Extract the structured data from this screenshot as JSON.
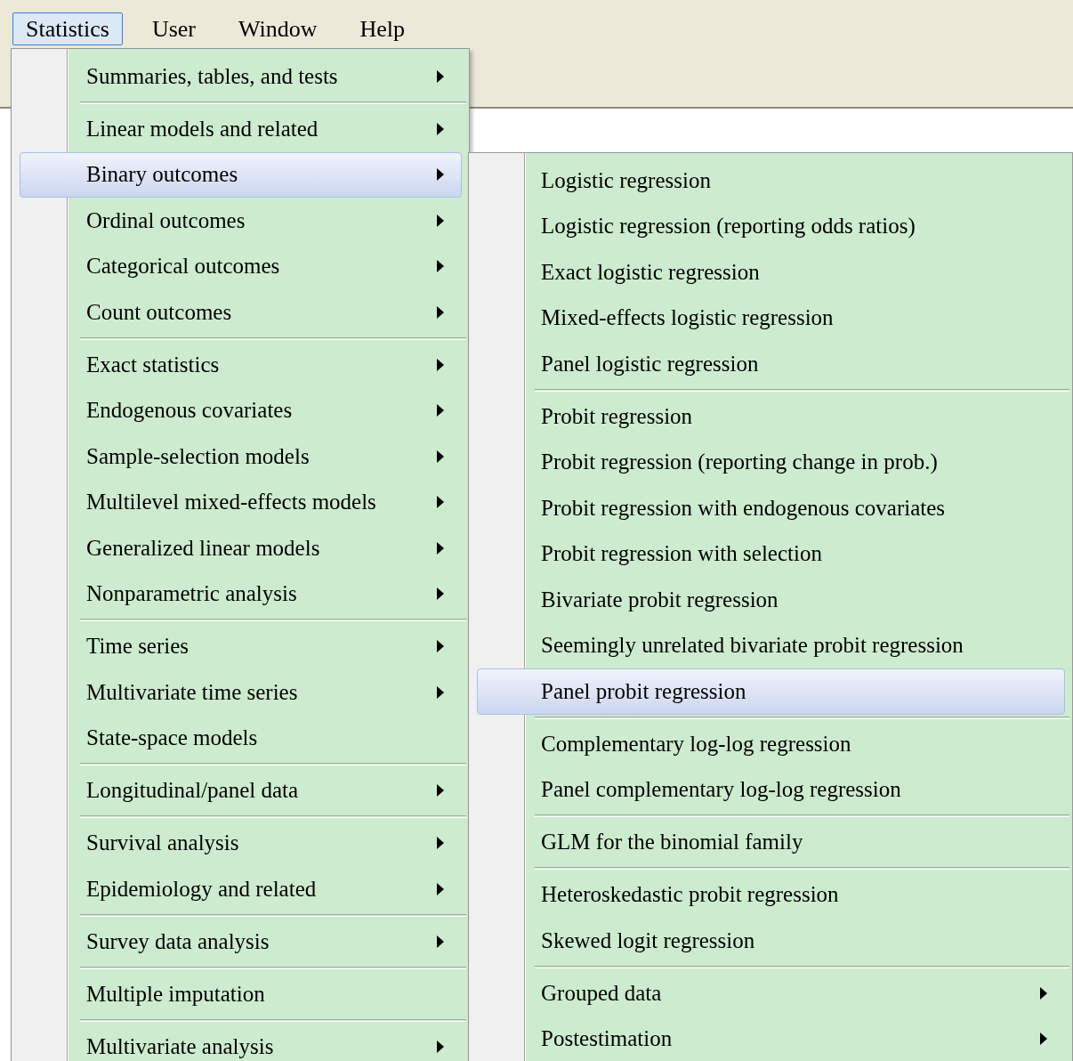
{
  "menu_bar": [
    {
      "label": "Statistics",
      "selected": true
    },
    {
      "label": "User",
      "selected": false
    },
    {
      "label": "Window",
      "selected": false
    },
    {
      "label": "Help",
      "selected": false
    }
  ],
  "statistics_menu": [
    {
      "kind": "item",
      "label": "Summaries, tables, and tests",
      "submenu": true,
      "selected": false
    },
    {
      "kind": "separator"
    },
    {
      "kind": "item",
      "label": "Linear models and related",
      "submenu": true,
      "selected": false
    },
    {
      "kind": "item",
      "label": "Binary outcomes",
      "submenu": true,
      "selected": true
    },
    {
      "kind": "item",
      "label": "Ordinal outcomes",
      "submenu": true,
      "selected": false
    },
    {
      "kind": "item",
      "label": "Categorical outcomes",
      "submenu": true,
      "selected": false
    },
    {
      "kind": "item",
      "label": "Count outcomes",
      "submenu": true,
      "selected": false
    },
    {
      "kind": "separator"
    },
    {
      "kind": "item",
      "label": "Exact statistics",
      "submenu": true,
      "selected": false
    },
    {
      "kind": "item",
      "label": "Endogenous covariates",
      "submenu": true,
      "selected": false
    },
    {
      "kind": "item",
      "label": "Sample-selection models",
      "submenu": true,
      "selected": false
    },
    {
      "kind": "item",
      "label": "Multilevel mixed-effects models",
      "submenu": true,
      "selected": false
    },
    {
      "kind": "item",
      "label": "Generalized linear models",
      "submenu": true,
      "selected": false
    },
    {
      "kind": "item",
      "label": "Nonparametric analysis",
      "submenu": true,
      "selected": false
    },
    {
      "kind": "separator"
    },
    {
      "kind": "item",
      "label": "Time series",
      "submenu": true,
      "selected": false
    },
    {
      "kind": "item",
      "label": "Multivariate time series",
      "submenu": true,
      "selected": false
    },
    {
      "kind": "item",
      "label": "State-space models",
      "submenu": false,
      "selected": false
    },
    {
      "kind": "separator"
    },
    {
      "kind": "item",
      "label": "Longitudinal/panel data",
      "submenu": true,
      "selected": false
    },
    {
      "kind": "separator"
    },
    {
      "kind": "item",
      "label": "Survival analysis",
      "submenu": true,
      "selected": false
    },
    {
      "kind": "item",
      "label": "Epidemiology and related",
      "submenu": true,
      "selected": false
    },
    {
      "kind": "separator"
    },
    {
      "kind": "item",
      "label": "Survey data analysis",
      "submenu": true,
      "selected": false
    },
    {
      "kind": "separator"
    },
    {
      "kind": "item",
      "label": "Multiple imputation",
      "submenu": false,
      "selected": false
    },
    {
      "kind": "separator"
    },
    {
      "kind": "item",
      "label": "Multivariate analysis",
      "submenu": true,
      "selected": false
    }
  ],
  "binary_outcomes_menu": [
    {
      "kind": "item",
      "label": "Logistic regression",
      "submenu": false,
      "selected": false
    },
    {
      "kind": "item",
      "label": "Logistic regression (reporting odds ratios)",
      "submenu": false,
      "selected": false
    },
    {
      "kind": "item",
      "label": "Exact logistic regression",
      "submenu": false,
      "selected": false
    },
    {
      "kind": "item",
      "label": "Mixed-effects logistic regression",
      "submenu": false,
      "selected": false
    },
    {
      "kind": "item",
      "label": "Panel logistic regression",
      "submenu": false,
      "selected": false
    },
    {
      "kind": "separator"
    },
    {
      "kind": "item",
      "label": "Probit regression",
      "submenu": false,
      "selected": false
    },
    {
      "kind": "item",
      "label": "Probit regression (reporting change in prob.)",
      "submenu": false,
      "selected": false
    },
    {
      "kind": "item",
      "label": "Probit regression with endogenous covariates",
      "submenu": false,
      "selected": false
    },
    {
      "kind": "item",
      "label": "Probit regression with selection",
      "submenu": false,
      "selected": false
    },
    {
      "kind": "item",
      "label": "Bivariate probit regression",
      "submenu": false,
      "selected": false
    },
    {
      "kind": "item",
      "label": "Seemingly unrelated bivariate probit regression",
      "submenu": false,
      "selected": false
    },
    {
      "kind": "item",
      "label": "Panel probit regression",
      "submenu": false,
      "selected": true
    },
    {
      "kind": "separator"
    },
    {
      "kind": "item",
      "label": "Complementary log-log regression",
      "submenu": false,
      "selected": false
    },
    {
      "kind": "item",
      "label": "Panel complementary log-log regression",
      "submenu": false,
      "selected": false
    },
    {
      "kind": "separator"
    },
    {
      "kind": "item",
      "label": "GLM for the binomial family",
      "submenu": false,
      "selected": false
    },
    {
      "kind": "separator"
    },
    {
      "kind": "item",
      "label": "Heteroskedastic probit regression",
      "submenu": false,
      "selected": false
    },
    {
      "kind": "item",
      "label": "Skewed logit regression",
      "submenu": false,
      "selected": false
    },
    {
      "kind": "separator"
    },
    {
      "kind": "item",
      "label": "Grouped data",
      "submenu": true,
      "selected": false
    },
    {
      "kind": "item",
      "label": "Postestimation",
      "submenu": true,
      "selected": false
    }
  ]
}
